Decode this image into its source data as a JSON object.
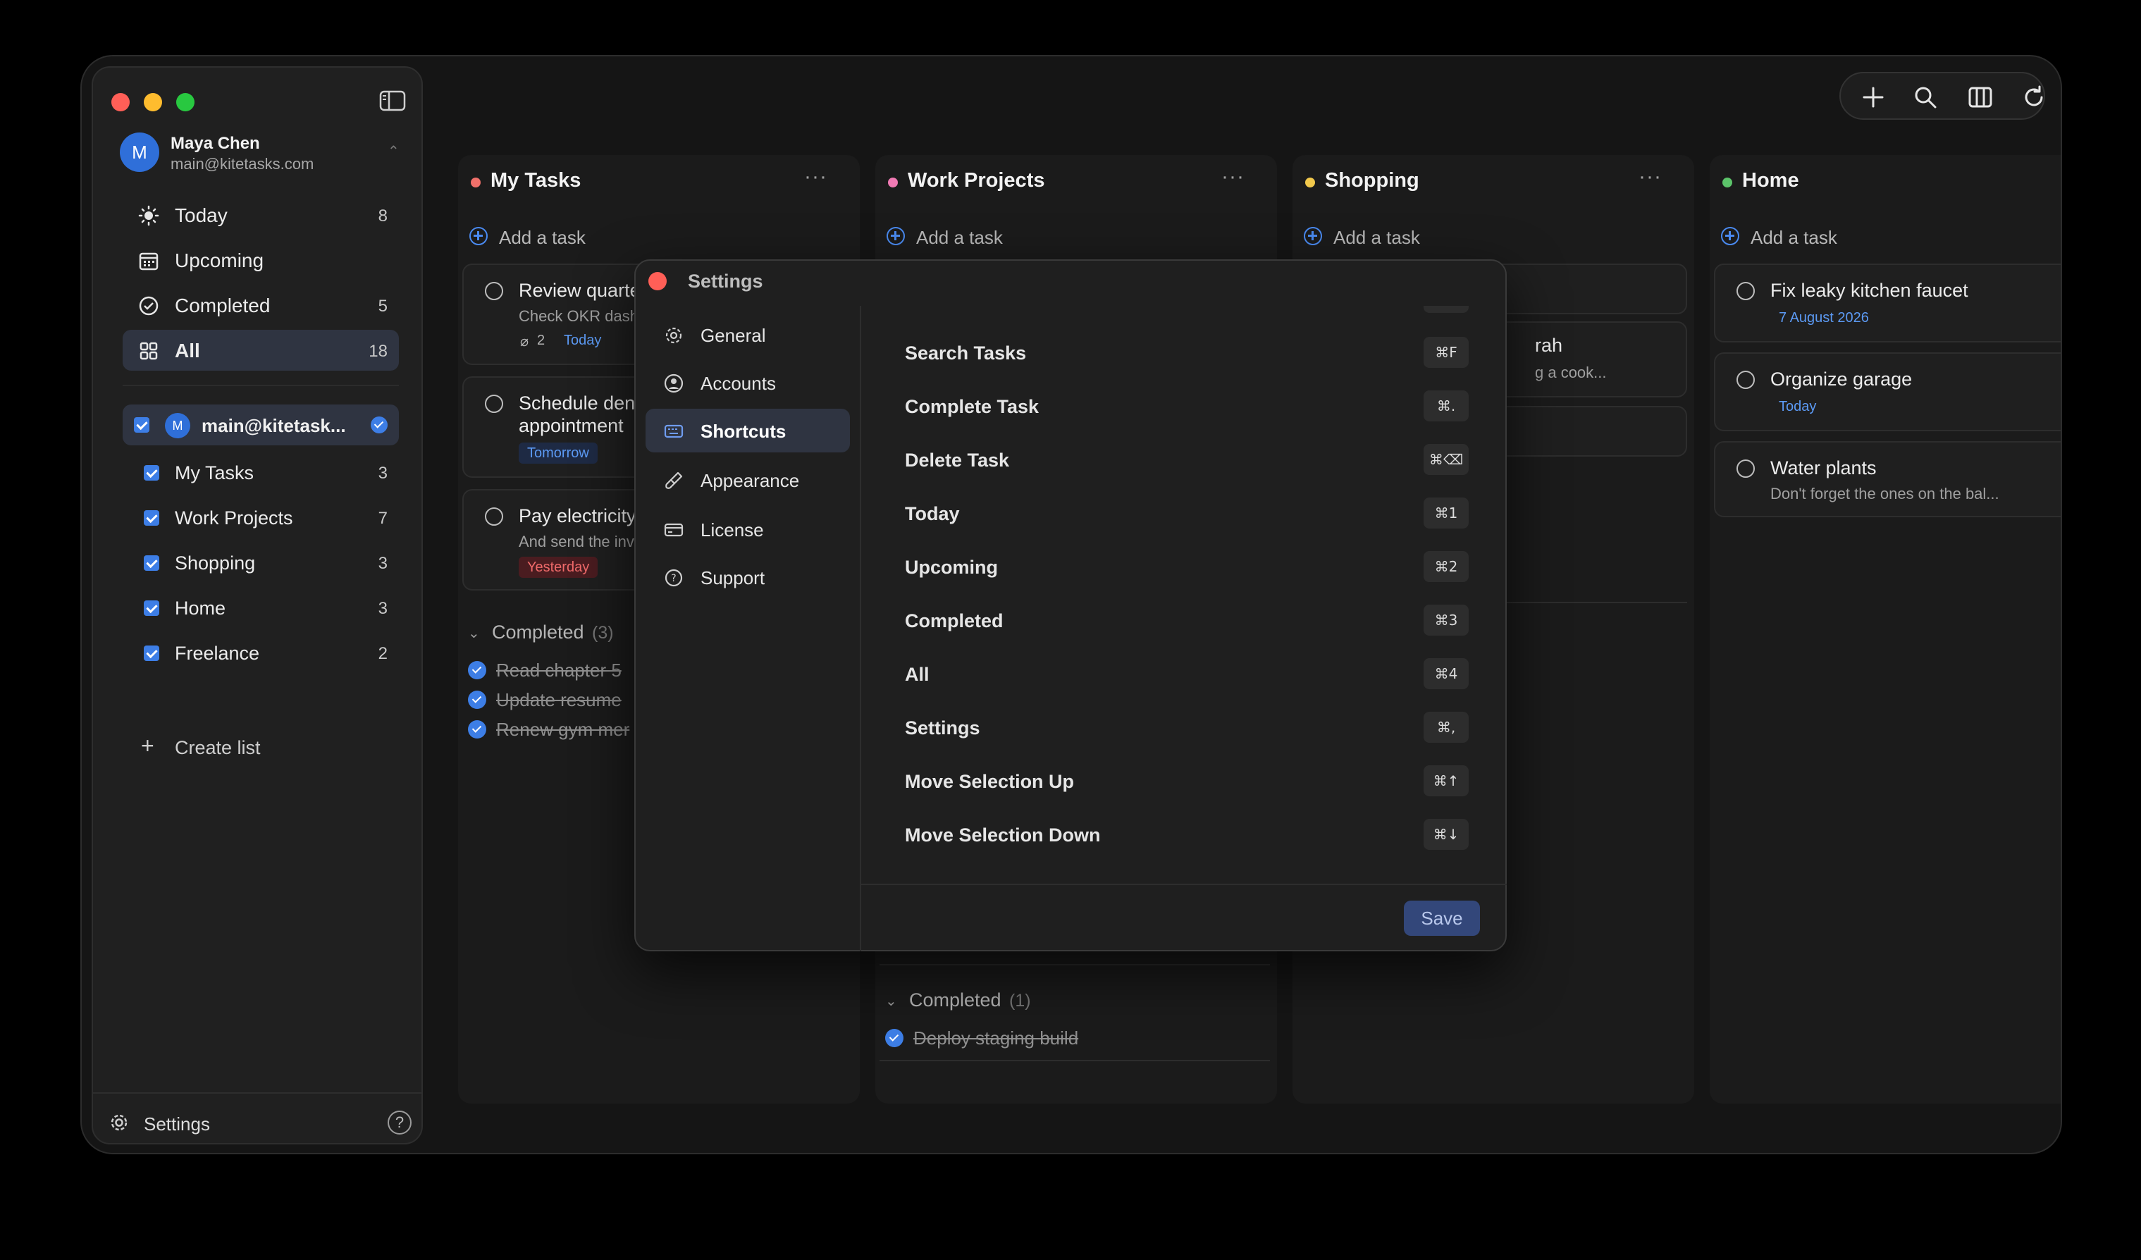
{
  "account": {
    "initial": "M",
    "name": "Maya Chen",
    "email": "main@kitetasks.com"
  },
  "nav": [
    {
      "label": "Today",
      "count": "8"
    },
    {
      "label": "Upcoming",
      "count": ""
    },
    {
      "label": "Completed",
      "count": "5"
    },
    {
      "label": "All",
      "count": "18"
    }
  ],
  "account_row": {
    "initial": "M",
    "label": "main@kitetask..."
  },
  "lists": [
    {
      "label": "My Tasks",
      "count": "3"
    },
    {
      "label": "Work Projects",
      "count": "7"
    },
    {
      "label": "Shopping",
      "count": "3"
    },
    {
      "label": "Home",
      "count": "3"
    },
    {
      "label": "Freelance",
      "count": "2"
    }
  ],
  "create_list": "Create list",
  "footer": {
    "settings": "Settings",
    "help": "?"
  },
  "add_task": "Add a task",
  "columns": {
    "my_tasks": {
      "title": "My Tasks",
      "color": "#f0706a",
      "tasks": [
        {
          "title": "Review quarte",
          "note": "Check OKR dash",
          "attachments": "2",
          "tag": "Today"
        },
        {
          "title": "Schedule dent",
          "title2": "appointment",
          "tag": "Tomorrow"
        },
        {
          "title": "Pay electricity",
          "note": "And send the inv",
          "tag": "Yesterday"
        }
      ],
      "completed_label": "Completed",
      "completed_count": "(3)",
      "completed": [
        "Read chapter 5",
        "Update resume",
        "Renew gym mer"
      ]
    },
    "work": {
      "title": "Work Projects",
      "color": "#f07ab4",
      "completed_label": "Completed",
      "completed_count": "(1)",
      "completed": [
        "Deploy staging build"
      ]
    },
    "shopping": {
      "title": "Shopping",
      "color": "#f2c94c",
      "partial_title": "rah",
      "partial_note": "g a cook..."
    },
    "home": {
      "title": "Home",
      "color": "#5cc46a",
      "tasks": [
        {
          "title": "Fix leaky kitchen faucet",
          "tag": "7 August 2026"
        },
        {
          "title": "Organize garage",
          "tag": "Today"
        },
        {
          "title": "Water plants",
          "note": "Don't forget the ones on the bal..."
        }
      ]
    }
  },
  "settings_dialog": {
    "title": "Settings",
    "nav": [
      "General",
      "Accounts",
      "Shortcuts",
      "Appearance",
      "License",
      "Support"
    ],
    "active": "Shortcuts",
    "shortcuts": [
      {
        "label": "Search Tasks",
        "key": "⌘F"
      },
      {
        "label": "Complete Task",
        "key": "⌘."
      },
      {
        "label": "Delete Task",
        "key": "⌘⌫"
      },
      {
        "label": "Today",
        "key": "⌘1"
      },
      {
        "label": "Upcoming",
        "key": "⌘2"
      },
      {
        "label": "Completed",
        "key": "⌘3"
      },
      {
        "label": "All",
        "key": "⌘4"
      },
      {
        "label": "Settings",
        "key": "⌘,"
      },
      {
        "label": "Move Selection Up",
        "key": "⌘↑"
      },
      {
        "label": "Move Selection Down",
        "key": "⌘↓"
      }
    ],
    "save": "Save"
  }
}
